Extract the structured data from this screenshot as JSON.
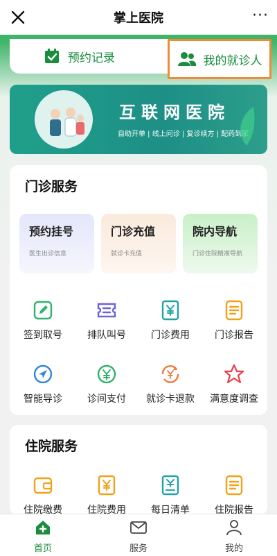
{
  "header": {
    "title": "掌上医院",
    "more": "···"
  },
  "tabs": [
    {
      "label": "预约记录"
    },
    {
      "label": "我的就诊人"
    }
  ],
  "banner": {
    "title": "互联网医院",
    "subtitle": "自助开单 | 线上问诊 | 复诊续方 | 配药到家"
  },
  "outpatient": {
    "heading": "门诊服务",
    "tiles": [
      {
        "title": "预约挂号",
        "sub": "医生出诊信息"
      },
      {
        "title": "门诊充值",
        "sub": "就诊卡充值"
      },
      {
        "title": "院内导航",
        "sub": "门诊住院精准导航"
      }
    ],
    "items": [
      {
        "label": "签到取号",
        "icon": "edit-icon"
      },
      {
        "label": "排队叫号",
        "icon": "ticket-icon"
      },
      {
        "label": "门诊费用",
        "icon": "yuan-doc-icon"
      },
      {
        "label": "门诊报告",
        "icon": "report-icon"
      },
      {
        "label": "智能导诊",
        "icon": "compass-icon"
      },
      {
        "label": "诊间支付",
        "icon": "yuan-circle-icon"
      },
      {
        "label": "就诊卡退款",
        "icon": "refund-icon"
      },
      {
        "label": "满意度调查",
        "icon": "star-icon"
      }
    ]
  },
  "inpatient": {
    "heading": "住院服务",
    "items": [
      {
        "label": "住院缴费",
        "icon": "wallet-icon"
      },
      {
        "label": "住院费用",
        "icon": "yuan-doc-icon"
      },
      {
        "label": "每日清单",
        "icon": "yuan-list-icon"
      },
      {
        "label": "住院报告",
        "icon": "report-icon"
      }
    ]
  },
  "nav": [
    {
      "label": "首页"
    },
    {
      "label": "服务"
    },
    {
      "label": "我的"
    }
  ],
  "colors": {
    "brand": "#1a8d3f",
    "highlight_border": "#f08a34"
  }
}
